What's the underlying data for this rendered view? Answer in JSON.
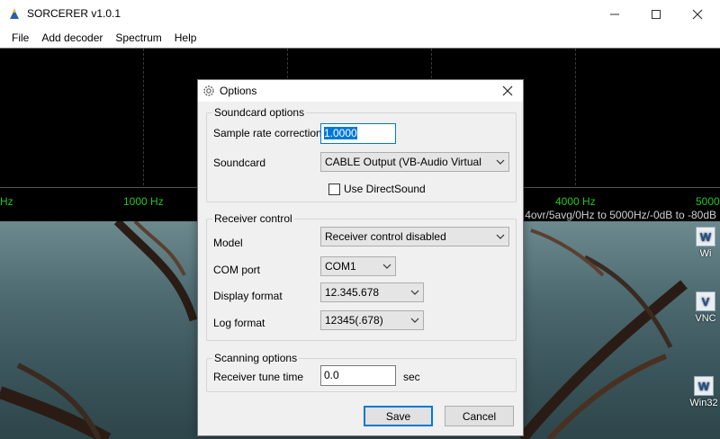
{
  "app": {
    "title": "SORCERER v1.0.1",
    "menu": [
      "File",
      "Add decoder",
      "Spectrum",
      "Help"
    ]
  },
  "spectrum": {
    "freq_labels": [
      "Hz",
      "1000 Hz",
      "4000 Hz",
      "5000"
    ],
    "status": "4ovr/5avg/0Hz to 5000Hz/-0dB to -80dB"
  },
  "desktop": {
    "icons": [
      "Wi",
      "VNC",
      "Win32"
    ]
  },
  "dialog": {
    "title": "Options",
    "soundcard": {
      "legend": "Soundcard options",
      "sample_rate_label": "Sample rate correction",
      "sample_rate_value": "1.0000",
      "soundcard_label": "Soundcard",
      "soundcard_value": "CABLE Output (VB-Audio Virtual",
      "directsound_label": "Use DirectSound",
      "directsound_checked": false
    },
    "receiver": {
      "legend": "Receiver control",
      "model_label": "Model",
      "model_value": "Receiver control disabled",
      "com_label": "COM port",
      "com_value": "COM1",
      "display_label": "Display format",
      "display_value": "12.345.678",
      "log_label": "Log format",
      "log_value": "12345(.678)"
    },
    "scanning": {
      "legend": "Scanning options",
      "tune_label": "Receiver tune time",
      "tune_value": "0.0",
      "tune_unit": "sec"
    },
    "save_label": "Save",
    "cancel_label": "Cancel"
  }
}
